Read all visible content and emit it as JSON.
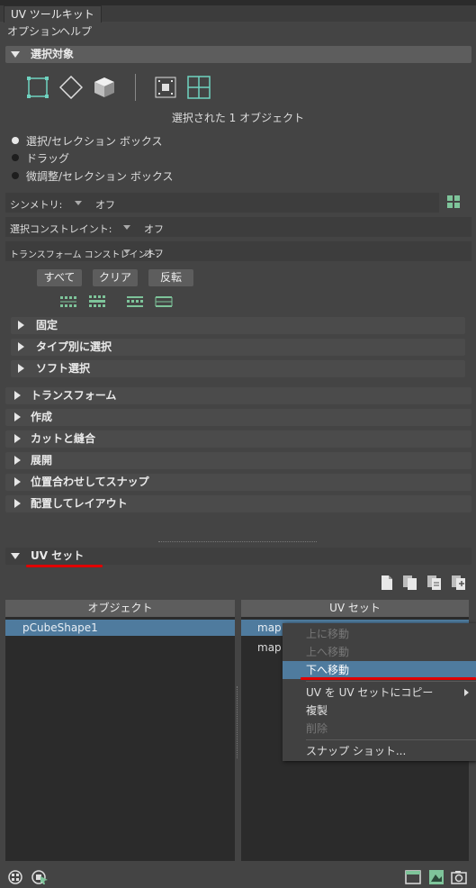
{
  "window": {
    "tab": "UV ツールキット"
  },
  "menubar": {
    "options": "オプション",
    "help": "ヘルプ"
  },
  "selection": {
    "title": "選択対象",
    "selected_text": "選択された 1 オブジェクト",
    "radios": [
      "選択/セレクション ボックス",
      "ドラッグ",
      "微調整/セレクション ボックス"
    ],
    "symmetry_label": "シンメトリ:",
    "symmetry_value": "オフ",
    "constraint_label": "選択コンストレイント:",
    "constraint_value": "オフ",
    "transform_constraint_label": "トランスフォーム コンストレイント:",
    "transform_constraint_value": "オフ",
    "buttons": [
      "すべて",
      "クリア",
      "反転"
    ],
    "subsections": [
      "固定",
      "タイプ別に選択",
      "ソフト選択"
    ]
  },
  "sections": [
    "トランスフォーム",
    "作成",
    "カットと縫合",
    "展開",
    "位置合わせしてスナップ",
    "配置してレイアウト"
  ],
  "uvsets": {
    "title": "UV セット",
    "objects_header": "オブジェクト",
    "uvsets_header": "UV セット",
    "objects": [
      "pCubeShape1"
    ],
    "sets": [
      "map",
      "map"
    ]
  },
  "context_menu": {
    "items": [
      "上に移動",
      "上へ移動",
      "下へ移動",
      "UV を UV セットにコピー",
      "複製",
      "削除",
      "スナップ ショット..."
    ]
  },
  "colors": {
    "highlight": "#4f7b9e",
    "accent_green": "#7ec49a",
    "underline_red": "#e00000"
  }
}
